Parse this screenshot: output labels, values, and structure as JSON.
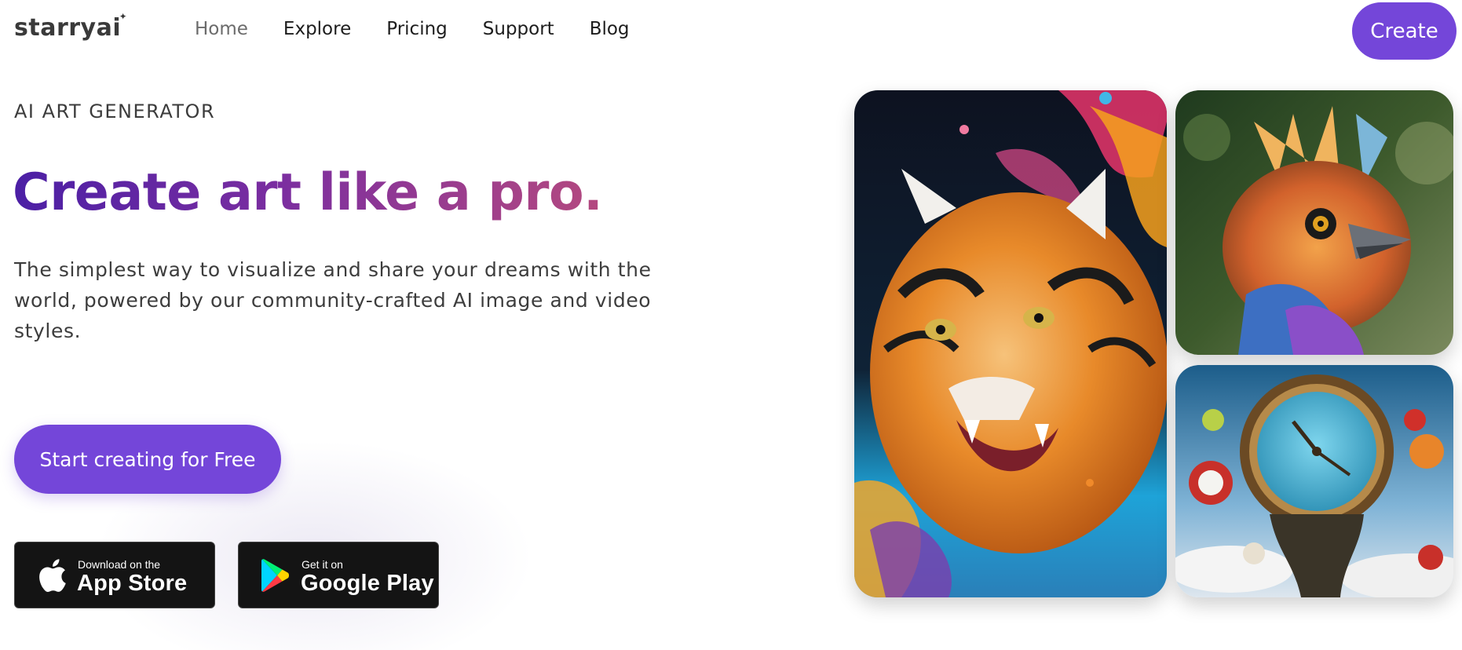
{
  "header": {
    "logo": "starryai",
    "nav": [
      "Home",
      "Explore",
      "Pricing",
      "Support",
      "Blog"
    ],
    "create_label": "Create"
  },
  "hero": {
    "eyebrow": "AI ART GENERATOR",
    "headline": "Create art like a pro.",
    "subtext": "The simplest way to visualize and share your dreams with the world, powered by our community-crafted AI image and video styles.",
    "cta_label": "Start creating for Free"
  },
  "stores": {
    "apple": {
      "small": "Download on the",
      "big": "App Store",
      "icon": "apple-icon"
    },
    "google": {
      "small": "Get it on",
      "big": "Google Play",
      "icon": "google-play-icon"
    }
  },
  "gallery": [
    {
      "name": "tiger-artwork"
    },
    {
      "name": "bird-artwork"
    },
    {
      "name": "clock-artwork"
    }
  ],
  "colors": {
    "accent": "#7446d9",
    "headline_gradient_start": "#4b1fa5",
    "headline_gradient_end": "#b4497f",
    "badge_bg": "#141414"
  }
}
